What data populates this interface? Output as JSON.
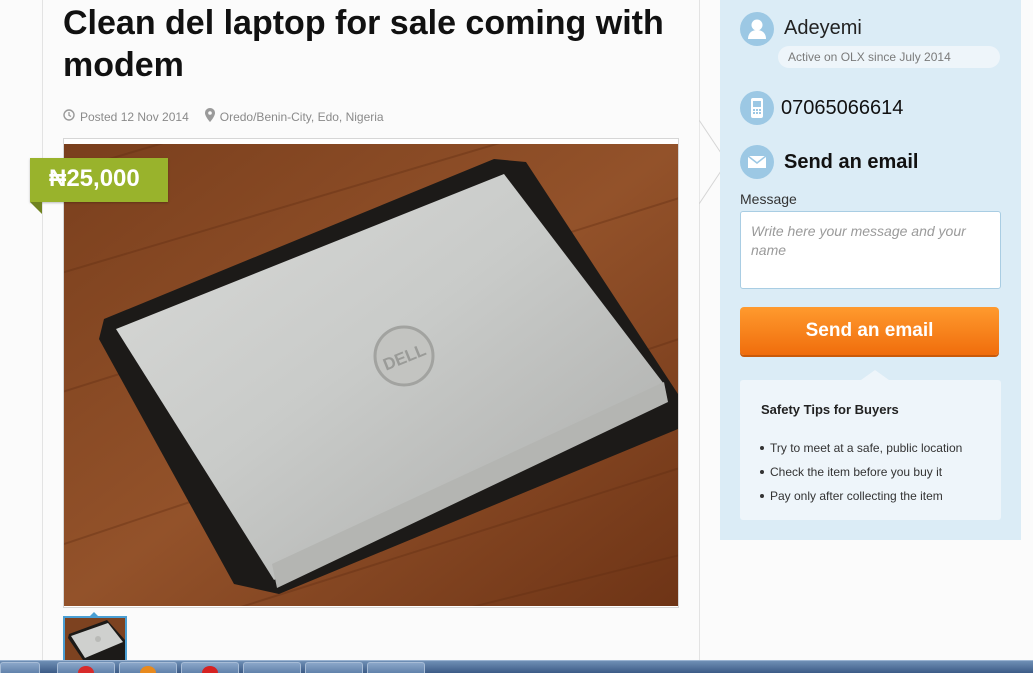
{
  "listing": {
    "title": "Clean del laptop for sale coming with modem",
    "posted": "Posted 12 Nov 2014",
    "location": "Oredo/Benin-City, Edo, Nigeria",
    "price": "₦25,000"
  },
  "seller": {
    "name": "Adeyemi",
    "since": "Active on OLX since July 2014",
    "phone": "07065066614"
  },
  "contact": {
    "title": "Send an email",
    "message_label": "Message",
    "message_placeholder": "Write here your message and your name",
    "send_button": "Send an email"
  },
  "safety": {
    "title": "Safety Tips for Buyers",
    "tips": [
      "Try to meet at a safe, public location",
      "Check the item before you buy it",
      "Pay only after collecting the item"
    ]
  },
  "colors": {
    "price_badge": "#99b32c",
    "send_button": "#f57c15",
    "sidebar_bg": "#dbecf6",
    "icon_circle": "#9cc8e4"
  },
  "icons": {
    "clock": "clock-icon",
    "pin": "map-pin-icon",
    "user": "user-icon",
    "phone": "phone-icon",
    "mail": "envelope-icon"
  }
}
